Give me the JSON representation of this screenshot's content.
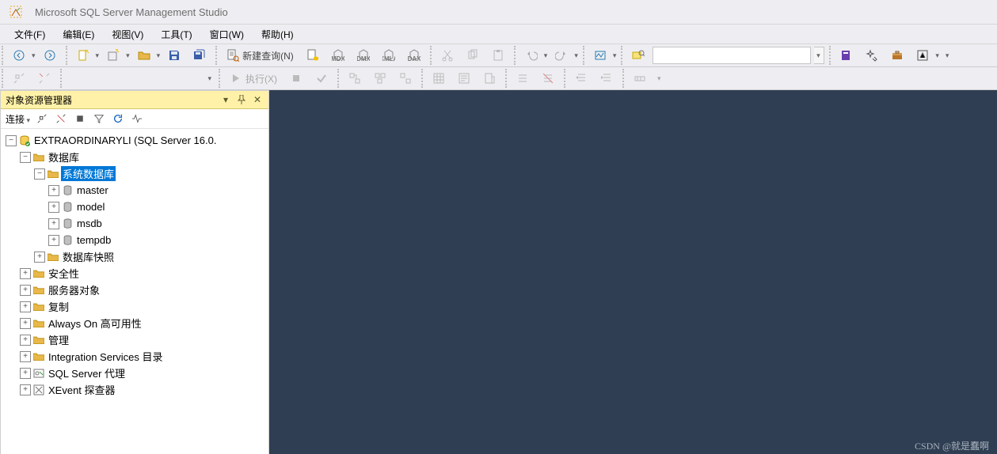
{
  "title": "Microsoft SQL Server Management Studio",
  "menus": [
    "文件(F)",
    "编辑(E)",
    "视图(V)",
    "工具(T)",
    "窗口(W)",
    "帮助(H)"
  ],
  "toolbar": {
    "new_query": "新建查询(N)",
    "execute": "执行(X)",
    "badges": {
      "mdx": "MDX",
      "dmx": "DMX",
      "xmla": "XMLA",
      "dax": "DAX"
    },
    "search_value": ""
  },
  "explorer": {
    "title": "对象资源管理器",
    "connect": "连接",
    "server": "EXTRAORDINARYLI (SQL Server 16.0.",
    "nodes": {
      "databases": "数据库",
      "system_databases": "系统数据库",
      "db_master": "master",
      "db_model": "model",
      "db_msdb": "msdb",
      "db_tempdb": "tempdb",
      "snapshots": "数据库快照",
      "security": "安全性",
      "server_objects": "服务器对象",
      "replication": "复制",
      "always_on": "Always On 高可用性",
      "management": "管理",
      "integration": "Integration Services 目录",
      "agent": "SQL Server 代理",
      "xevent": "XEvent 探查器"
    }
  },
  "watermark": "CSDN @就是蠢啊"
}
